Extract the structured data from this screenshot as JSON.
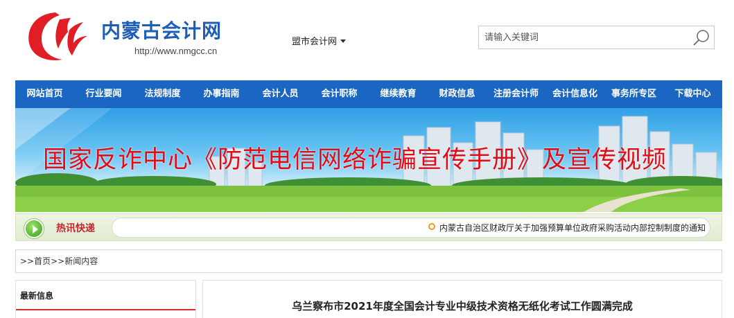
{
  "header": {
    "site_name": "内蒙古会计网",
    "site_url": "http://www.nmgcc.cn",
    "city_dropdown": "盟市会计网",
    "search_placeholder": "请输入关键词",
    "brand_color": "#1d5db5",
    "logo_color": "#e11d25"
  },
  "nav": {
    "color": "#1a66c2",
    "items": [
      "网站首页",
      "行业要闻",
      "法规制度",
      "办事指南",
      "会计人员",
      "会计职称",
      "继续教育",
      "财政信息",
      "注册会计师",
      "会计信息化",
      "事务所专区",
      "下载中心"
    ]
  },
  "banner": {
    "title": "国家反诈中心《防范电信网络诈骗宣传手册》及宣传视频"
  },
  "ticker": {
    "label": "热讯快递",
    "text": "内蒙古自治区财政厅关于加强预算单位政府采购活动内部控制制度的通知"
  },
  "breadcrumb": {
    "prefix": ">>",
    "home": "首页",
    "sep": ">>",
    "current": "新闻内容"
  },
  "sidebar": {
    "title": "最新信息"
  },
  "article": {
    "title": "乌兰察布市2021年度全国会计专业中级技术资格无纸化考试工作圆满完成"
  }
}
